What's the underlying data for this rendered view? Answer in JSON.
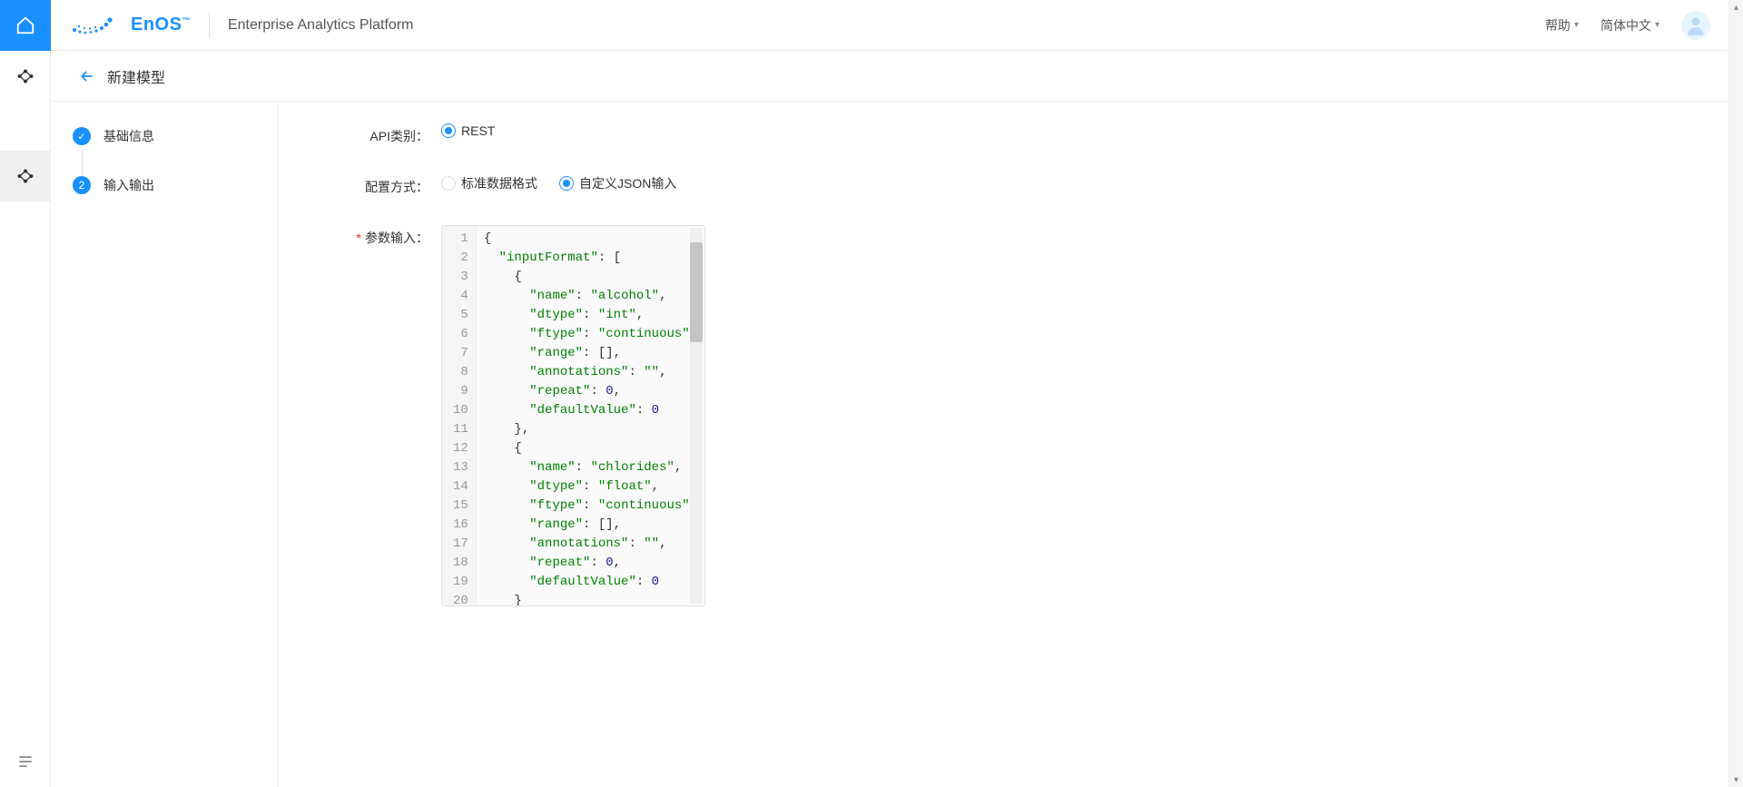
{
  "header": {
    "brand": "EnOS",
    "brand_tm": "™",
    "platform": "Enterprise Analytics Platform",
    "help": "帮助",
    "language": "简体中文"
  },
  "subheader": {
    "title": "新建模型"
  },
  "steps": [
    {
      "label": "基础信息",
      "done": true
    },
    {
      "label": "输入输出",
      "num": "2"
    }
  ],
  "form": {
    "api_type_label": "API类别：",
    "api_type_rest": "REST",
    "config_mode_label": "配置方式：",
    "config_mode_standard": "标准数据格式",
    "config_mode_custom": "自定义JSON输入",
    "param_input_label": "参数输入："
  },
  "editor": {
    "line_count": 20,
    "json_payload": {
      "inputFormat": [
        {
          "name": "alcohol",
          "dtype": "int",
          "ftype": "continuous",
          "range": [],
          "annotations": "",
          "repeat": 0,
          "defaultValue": 0
        },
        {
          "name": "chlorides",
          "dtype": "float",
          "ftype": "continuous",
          "range": [],
          "annotations": "",
          "repeat": 0,
          "defaultValue": 0
        }
      ]
    }
  }
}
